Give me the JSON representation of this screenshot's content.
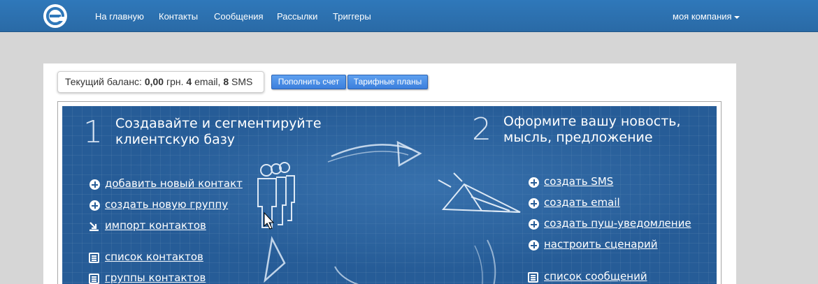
{
  "nav": {
    "logo": "logo-e-icon",
    "links": [
      "На главную",
      "Контакты",
      "Сообщения",
      "Рассылки",
      "Триггеры"
    ],
    "company": "моя компания"
  },
  "balance": {
    "label": "Текущий баланс:",
    "amount": "0,00",
    "currency": "грн.",
    "email_count": "4",
    "email_label": "email,",
    "sms_count": "8",
    "sms_label": "SMS"
  },
  "buttons": {
    "topup": "Пополнить счет",
    "plans": "Тарифные планы"
  },
  "steps": [
    {
      "number": "1",
      "title_line1": "Создавайте и сегментируйте",
      "title_line2": "клиентскую базу",
      "actions": [
        "добавить новый контакт",
        "создать новую группу",
        "импорт контактов"
      ],
      "lists": [
        "список контактов",
        "группы контактов"
      ]
    },
    {
      "number": "2",
      "title_line1": "Оформите вашу новость,",
      "title_line2": "мысль, предложение",
      "actions": [
        "создать SMS",
        "создать email",
        "создать пуш-уведомление",
        "настроить сценарий"
      ],
      "lists": [
        "список сообщений"
      ]
    }
  ],
  "colors": {
    "navbar": "#2f78ba",
    "blueprint": "#265c97",
    "button": "#4a8fe6"
  }
}
